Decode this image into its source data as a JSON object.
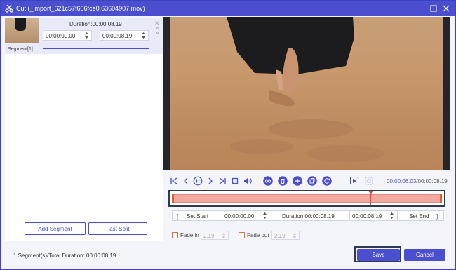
{
  "window": {
    "title": "Cut (_import_621c57f606fce0.63604907.mov)"
  },
  "segment_panel": {
    "duration_label": "Duration:00:00:08.19",
    "start_time": "00:00:00.00",
    "end_time": "00:00:08.19",
    "segment_label": "Segment[1]",
    "add_segment_label": "Add Segment",
    "fast_split_label": "Fast Split"
  },
  "status": {
    "summary": "1 Segment(s)/Total Duration: 00:00:08.19"
  },
  "player": {
    "current_time": "00:00:06.03",
    "total_time": "/00:00:08.19",
    "playhead_fraction": 0.736
  },
  "trim": {
    "set_start_label": "Set Start",
    "start_value": "00:00:00.00",
    "duration_label": "Duration:00:00:08.19",
    "end_value": "00:00:08.19",
    "set_end_label": "Set End"
  },
  "fade": {
    "fade_in_label": "Fade in",
    "fade_in_value": "2.19",
    "fade_out_label": "Fade out",
    "fade_out_value": "2.19"
  },
  "footer": {
    "save_label": "Save",
    "cancel_label": "Cancel"
  },
  "colors": {
    "accent": "#4b4fcf",
    "range": "#f2a9a0",
    "playhead": "#e0463a"
  }
}
